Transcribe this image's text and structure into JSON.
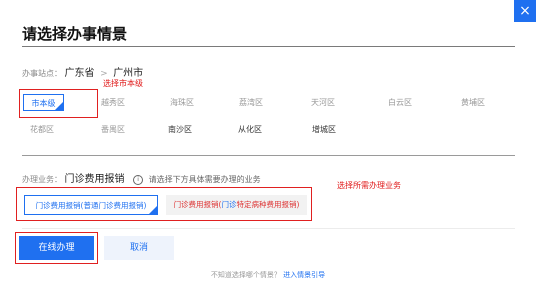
{
  "dialog": {
    "title": "请选择办事情景",
    "close_label": "×"
  },
  "site": {
    "label": "办事站点：",
    "province": "广东省",
    "separator": ">",
    "city": "广州市"
  },
  "regions": [
    {
      "label": "市本级",
      "selected": true
    },
    {
      "label": "越秀区"
    },
    {
      "label": "海珠区"
    },
    {
      "label": "荔湾区"
    },
    {
      "label": "天河区"
    },
    {
      "label": "白云区"
    },
    {
      "label": "黄埔区"
    },
    {
      "label": "花都区"
    },
    {
      "label": "番禺区"
    },
    {
      "label": "南沙区"
    },
    {
      "label": "从化区"
    },
    {
      "label": "增城区"
    }
  ],
  "annotations": {
    "select_city_level": "选择市本级",
    "select_business": "选择所需办理业务"
  },
  "business": {
    "label": "办理业务：",
    "value": "门诊费用报销",
    "hint": "请选择下方具体需要办理的业务",
    "info_icon": "info-icon",
    "options": [
      {
        "label": "门诊费用报销(普通门诊费用报销)",
        "selected": true
      },
      {
        "label_red1": "门诊费用报销(",
        "label_blue": "门诊",
        "label_red2": "特定病种费用报销)"
      }
    ]
  },
  "actions": {
    "primary": "在线办理",
    "secondary": "取消"
  },
  "footer": {
    "text": "不知道选择哪个情景？",
    "link": "进入情景引导"
  },
  "colors": {
    "accent": "#1f70f0",
    "annotation": "#e01818"
  }
}
